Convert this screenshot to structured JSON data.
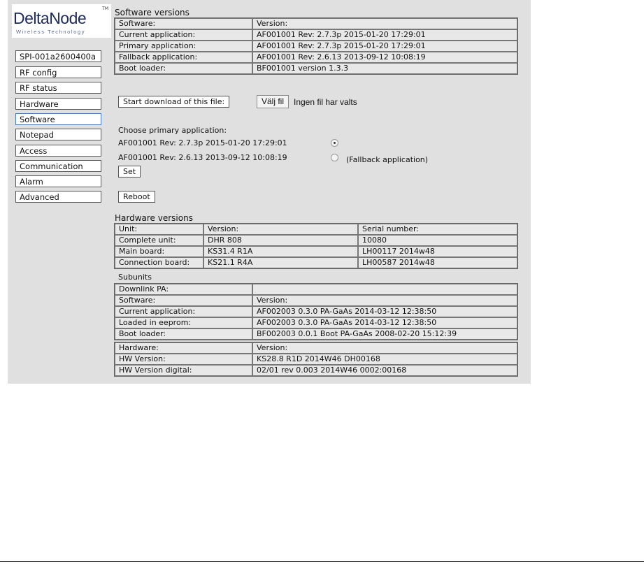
{
  "brand": {
    "name": "DeltaNode",
    "tm": "TM",
    "tagline": "Wireless Technology"
  },
  "sidebar": {
    "items": [
      {
        "label": "SPI-001a2600400a"
      },
      {
        "label": "RF config"
      },
      {
        "label": "RF status"
      },
      {
        "label": "Hardware"
      },
      {
        "label": "Software",
        "active": true
      },
      {
        "label": "Notepad"
      },
      {
        "label": "Access"
      },
      {
        "label": "Communication"
      },
      {
        "label": "Alarm"
      },
      {
        "label": "Advanced"
      }
    ]
  },
  "software_versions": {
    "title": "Software versions",
    "header": [
      "Software:",
      "Version:"
    ],
    "rows": [
      [
        "Current application:",
        "AF001001 Rev: 2.7.3p 2015-01-20 17:29:01"
      ],
      [
        "Primary application:",
        "AF001001 Rev: 2.7.3p 2015-01-20 17:29:01"
      ],
      [
        "Fallback application:",
        "AF001001 Rev: 2.6.13 2013-09-12 10:08:19"
      ],
      [
        "Boot loader:",
        "BF001001 version 1.3.3"
      ]
    ]
  },
  "download": {
    "button": "Start download of this file:",
    "file_button": "Välj fil",
    "file_status": "Ingen fil har valts"
  },
  "primary": {
    "label": "Choose primary application:",
    "options": [
      {
        "text": "AF001001 Rev: 2.7.3p 2015-01-20 17:29:01",
        "note": "",
        "selected": true
      },
      {
        "text": "AF001001 Rev: 2.6.13 2013-09-12 10:08:19",
        "note": "(Fallback application)",
        "selected": false
      }
    ],
    "set_button": "Set"
  },
  "reboot_button": "Reboot",
  "hardware_versions": {
    "title": "Hardware versions",
    "header": [
      "Unit:",
      "Version:",
      "Serial number:"
    ],
    "rows": [
      [
        "Complete unit:",
        "DHR 808",
        "10080"
      ],
      [
        "Main board:",
        "KS31.4 R1A",
        "LH00117 2014w48"
      ],
      [
        "Connection board:",
        "KS21.1 R4A",
        "LH00587 2014w48"
      ]
    ]
  },
  "subunits": {
    "title": "Subunits",
    "name": "Downlink PA:",
    "software_header": [
      "Software:",
      "Version:"
    ],
    "software_rows": [
      [
        "Current application:",
        "AF002003 0.3.0 PA-GaAs 2014-03-12 12:38:50"
      ],
      [
        "Loaded in eeprom:",
        "AF002003 0.3.0 PA-GaAs 2014-03-12 12:38:50"
      ],
      [
        "Boot loader:",
        "BF002003 0.0.1 Boot PA-GaAs 2008-02-20 15:12:39"
      ]
    ],
    "hardware_header": [
      "Hardware:",
      "Version:"
    ],
    "hardware_rows": [
      [
        "HW Version:",
        "KS28.8 R1D 2014W46 DH00168"
      ],
      [
        "HW Version digital:",
        "02/01 rev 0.003 2014W46 0002:00168"
      ]
    ]
  }
}
